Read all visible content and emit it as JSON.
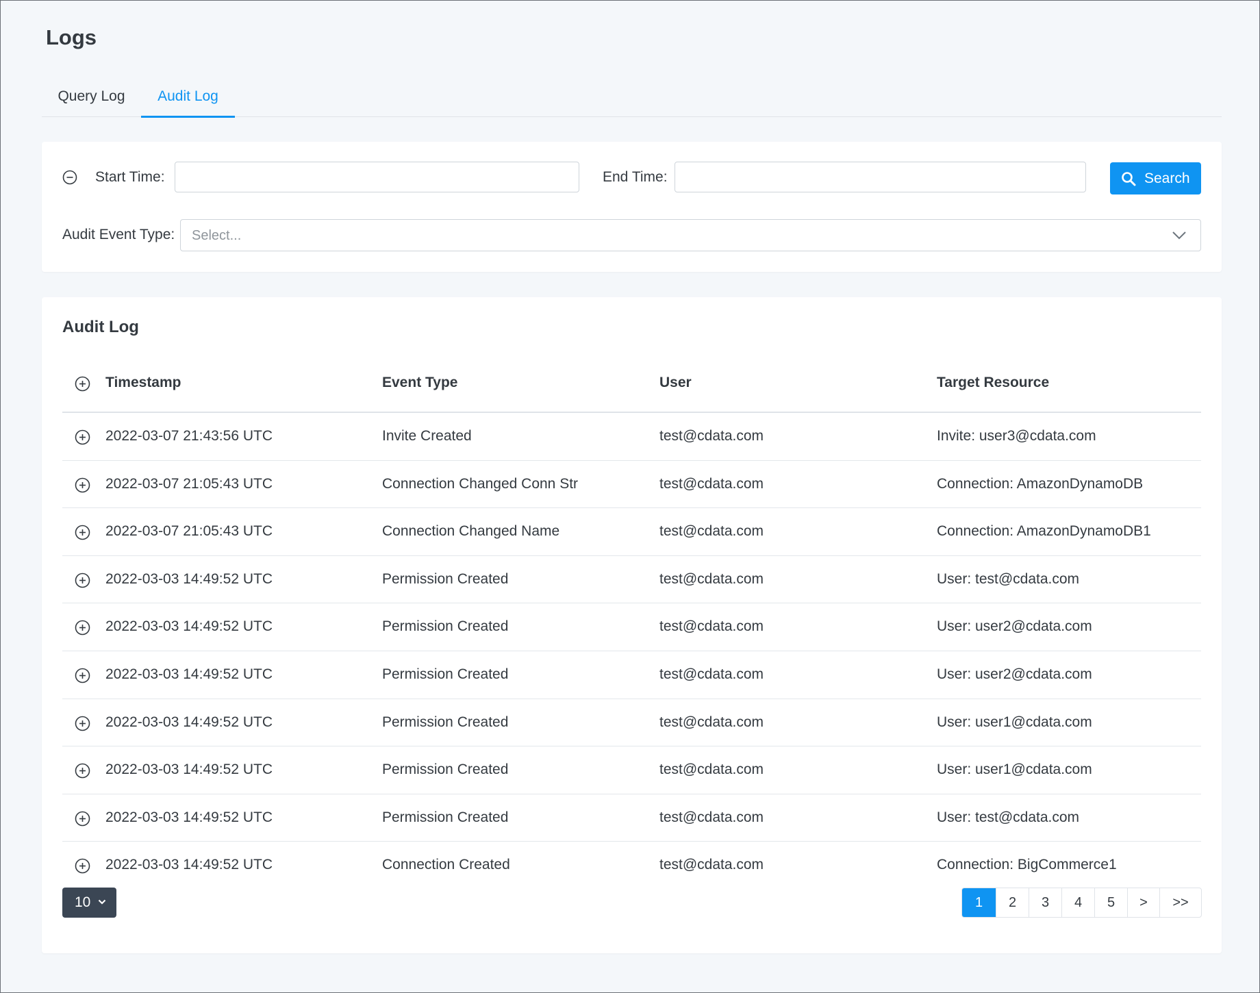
{
  "page": {
    "title": "Logs"
  },
  "tabs": [
    {
      "label": "Query Log",
      "active": false
    },
    {
      "label": "Audit Log",
      "active": true
    }
  ],
  "filters": {
    "collapse_icon": "minus-circle-icon",
    "start_label": "Start Time:",
    "start_value": "",
    "end_label": "End Time:",
    "end_value": "",
    "search_label": "Search",
    "search_icon": "search-icon",
    "event_type_label": "Audit Event Type:",
    "event_type_placeholder": "Select...",
    "event_type_chevron": "chevron-down-icon"
  },
  "audit_log": {
    "title": "Audit Log",
    "expand_icon": "plus-circle-icon",
    "columns": [
      "Timestamp",
      "Event Type",
      "User",
      "Target Resource"
    ],
    "rows": [
      {
        "timestamp": "2022-03-07 21:43:56 UTC",
        "event": "Invite Created",
        "user": "test@cdata.com",
        "target": "Invite: user3@cdata.com"
      },
      {
        "timestamp": "2022-03-07 21:05:43 UTC",
        "event": "Connection Changed Conn Str",
        "user": "test@cdata.com",
        "target": "Connection: AmazonDynamoDB"
      },
      {
        "timestamp": "2022-03-07 21:05:43 UTC",
        "event": "Connection Changed Name",
        "user": "test@cdata.com",
        "target": "Connection: AmazonDynamoDB1"
      },
      {
        "timestamp": "2022-03-03 14:49:52 UTC",
        "event": "Permission Created",
        "user": "test@cdata.com",
        "target": "User: test@cdata.com"
      },
      {
        "timestamp": "2022-03-03 14:49:52 UTC",
        "event": "Permission Created",
        "user": "test@cdata.com",
        "target": "User: user2@cdata.com"
      },
      {
        "timestamp": "2022-03-03 14:49:52 UTC",
        "event": "Permission Created",
        "user": "test@cdata.com",
        "target": "User: user2@cdata.com"
      },
      {
        "timestamp": "2022-03-03 14:49:52 UTC",
        "event": "Permission Created",
        "user": "test@cdata.com",
        "target": "User: user1@cdata.com"
      },
      {
        "timestamp": "2022-03-03 14:49:52 UTC",
        "event": "Permission Created",
        "user": "test@cdata.com",
        "target": "User: user1@cdata.com"
      },
      {
        "timestamp": "2022-03-03 14:49:52 UTC",
        "event": "Permission Created",
        "user": "test@cdata.com",
        "target": "User: test@cdata.com"
      },
      {
        "timestamp": "2022-03-03 14:49:52 UTC",
        "event": "Connection Created",
        "user": "test@cdata.com",
        "target": "Connection: BigCommerce1"
      }
    ]
  },
  "pagination": {
    "page_size": "10",
    "page_size_icon": "chevron-down-icon",
    "pages": [
      "1",
      "2",
      "3",
      "4",
      "5",
      ">",
      ">>"
    ],
    "active_page": "1"
  },
  "colors": {
    "accent": "#0f94f2",
    "page_bg": "#f4f7fa",
    "text": "#343a40",
    "pagesize_bg": "#3b4654"
  }
}
